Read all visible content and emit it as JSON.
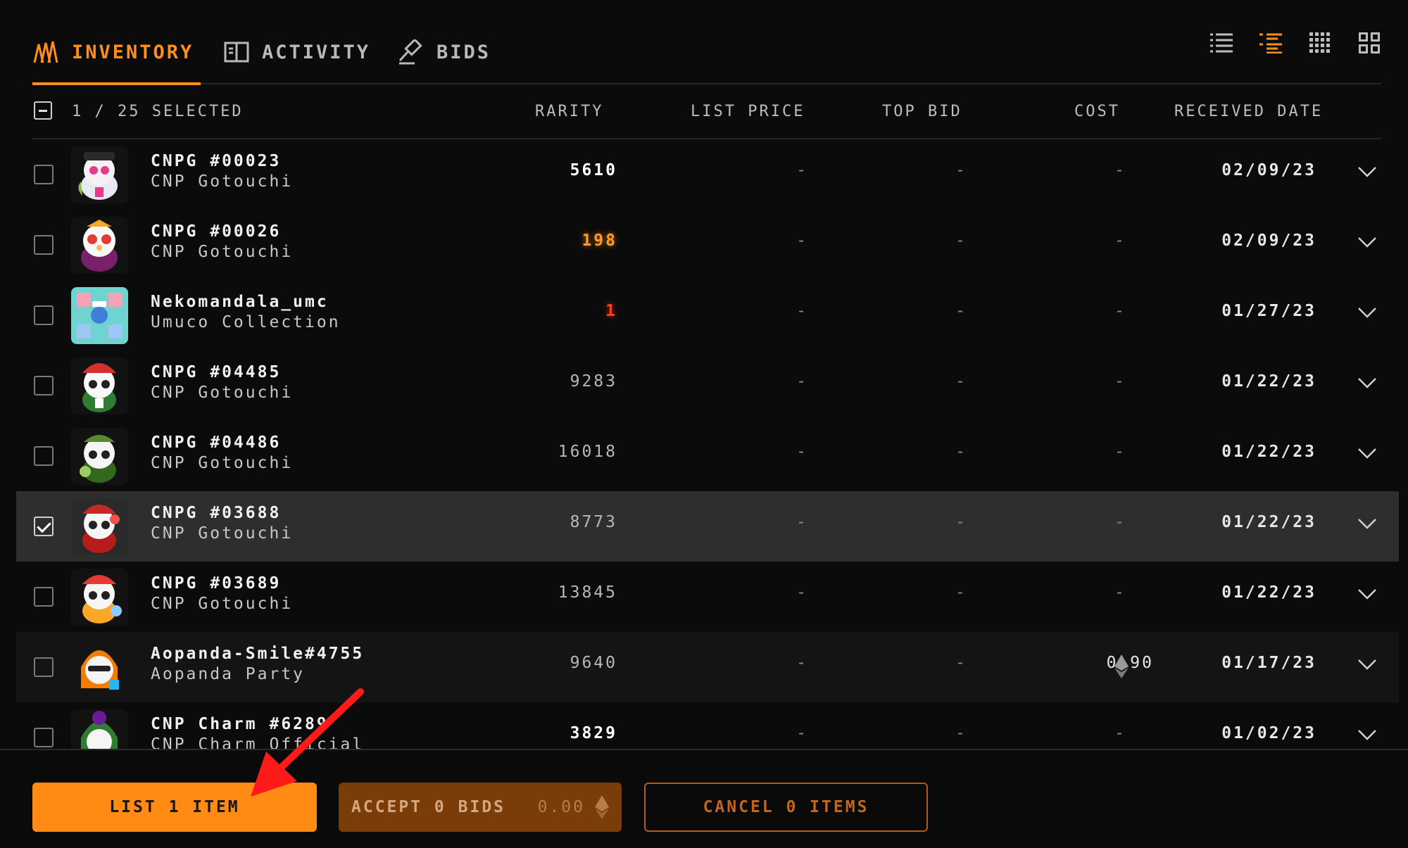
{
  "tabs": [
    {
      "label": "INVENTORY",
      "icon": "inventory-icon",
      "active": true
    },
    {
      "label": "ACTIVITY",
      "icon": "activity-book-icon",
      "active": false
    },
    {
      "label": "BIDS",
      "icon": "gavel-icon",
      "active": false
    }
  ],
  "view_icons": [
    "list-compact-icon",
    "list-detail-icon",
    "grid-small-icon",
    "grid-large-icon"
  ],
  "header": {
    "selected": "1 / 25 SELECTED",
    "rarity": "RARITY",
    "list_price": "LIST PRICE",
    "top_bid": "TOP BID",
    "cost": "COST",
    "received_date": "RECEIVED DATE"
  },
  "rows": [
    {
      "name": "CNPG #00023",
      "collection": "CNP Gotouchi",
      "rarity": "5610",
      "list_price": "-",
      "top_bid": "-",
      "cost": "-",
      "date": "02/09/23"
    },
    {
      "name": "CNPG #00026",
      "collection": "CNP Gotouchi",
      "rarity": "198",
      "list_price": "-",
      "top_bid": "-",
      "cost": "-",
      "date": "02/09/23"
    },
    {
      "name": "Nekomandala_umc",
      "collection": "Umuco Collection",
      "rarity": "1",
      "list_price": "-",
      "top_bid": "-",
      "cost": "-",
      "date": "01/27/23"
    },
    {
      "name": "CNPG #04485",
      "collection": "CNP Gotouchi",
      "rarity": "9283",
      "list_price": "-",
      "top_bid": "-",
      "cost": "-",
      "date": "01/22/23"
    },
    {
      "name": "CNPG #04486",
      "collection": "CNP Gotouchi",
      "rarity": "16018",
      "list_price": "-",
      "top_bid": "-",
      "cost": "-",
      "date": "01/22/23"
    },
    {
      "name": "CNPG #03688",
      "collection": "CNP Gotouchi",
      "rarity": "8773",
      "list_price": "-",
      "top_bid": "-",
      "cost": "-",
      "date": "01/22/23"
    },
    {
      "name": "CNPG #03689",
      "collection": "CNP Gotouchi",
      "rarity": "13845",
      "list_price": "-",
      "top_bid": "-",
      "cost": "-",
      "date": "01/22/23"
    },
    {
      "name": "Aopanda-Smile#4755",
      "collection": "Aopanda Party",
      "rarity": "9640",
      "list_price": "-",
      "top_bid": "-",
      "cost": "0.90",
      "date": "01/17/23"
    },
    {
      "name": "CNP Charm #6289",
      "collection": "CNP Charm Official",
      "rarity": "3829",
      "list_price": "-",
      "top_bid": "-",
      "cost": "-",
      "date": "01/02/23"
    }
  ],
  "footer": {
    "list_label": "LIST 1 ITEM",
    "accept_label": "ACCEPT 0 BIDS",
    "accept_amount": "0.00",
    "cancel_label": "CANCEL 0 ITEMS"
  },
  "colors": {
    "accent": "#ff8a14",
    "background": "#0b0b0b",
    "selected_row": "#2e2e2e",
    "arrow": "#ff1a1a"
  }
}
